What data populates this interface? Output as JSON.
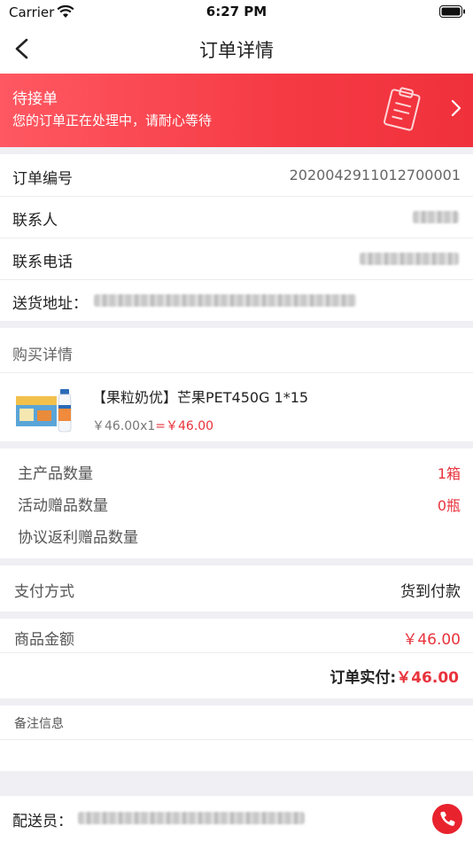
{
  "status_bar": {
    "carrier": "Carrier",
    "time": "6:27 PM"
  },
  "nav": {
    "title": "订单详情"
  },
  "banner": {
    "title": "待接单",
    "subtitle": "您的订单正在处理中，请耐心等待"
  },
  "order_info": {
    "order_no_label": "订单编号",
    "order_no_value": "2020042911012700001",
    "contact_label": "联系人",
    "phone_label": "联系电话",
    "address_label": "送货地址："
  },
  "purchase": {
    "header": "购买详情",
    "product_name": "【果粒奶优】芒果PET450G 1*15",
    "unit_qty": "￥46.00x1",
    "equals": "=",
    "subtotal": "￥46.00"
  },
  "quantities": {
    "main_label": "主产品数量",
    "main_value": "1箱",
    "gift_label": "活动赠品数量",
    "gift_value": "0瓶",
    "rebate_label": "协议返利赠品数量"
  },
  "payment": {
    "label": "支付方式",
    "value": "货到付款"
  },
  "amount": {
    "goods_label": "商品金额",
    "goods_value": "￥46.00",
    "paid_label": "订单实付:",
    "paid_value": "￥46.00"
  },
  "remark": {
    "label": "备注信息"
  },
  "delivery": {
    "label": "配送员："
  },
  "colors": {
    "accent": "#e8333c",
    "banner_start": "#ff5862",
    "banner_end": "#f0313c"
  }
}
